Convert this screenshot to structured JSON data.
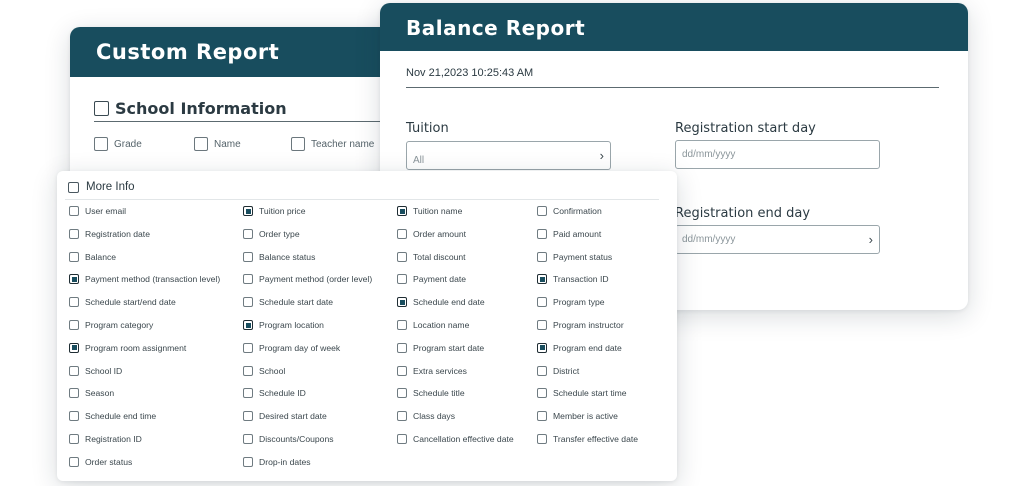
{
  "custom_report": {
    "title": "Custom Report",
    "section_title": "School Information",
    "fields": [
      "Grade",
      "Name",
      "Teacher name"
    ]
  },
  "balance_report": {
    "title": "Balance Report",
    "datetime": "Nov 21,2023  10:25:43 AM",
    "tuition_label": "Tuition",
    "tuition_value": "All",
    "reg_start_label": "Registration start day",
    "reg_start_placeholder": "dd/mm/yyyy",
    "reg_end_label": "Registration end day",
    "reg_end_placeholder": "dd/mm/yyyy"
  },
  "more_info": {
    "title": "More Info",
    "columns": [
      [
        {
          "label": "User email",
          "checked": false
        },
        {
          "label": "Registration date",
          "checked": false
        },
        {
          "label": "Balance",
          "checked": false
        },
        {
          "label": "Payment method (transaction level)",
          "checked": true
        },
        {
          "label": "Schedule start/end date",
          "checked": false
        },
        {
          "label": "Program category",
          "checked": false
        },
        {
          "label": "Program room assignment",
          "checked": true
        },
        {
          "label": "School ID",
          "checked": false
        },
        {
          "label": "Season",
          "checked": false
        },
        {
          "label": "Schedule end time",
          "checked": false
        },
        {
          "label": "Registration ID",
          "checked": false
        },
        {
          "label": "Order status",
          "checked": false
        }
      ],
      [
        {
          "label": "Tuition price",
          "checked": true
        },
        {
          "label": "Order type",
          "checked": false
        },
        {
          "label": "Balance status",
          "checked": false
        },
        {
          "label": "Payment method (order level)",
          "checked": false
        },
        {
          "label": "Schedule start date",
          "checked": false
        },
        {
          "label": "Program location",
          "checked": true
        },
        {
          "label": "Program day of week",
          "checked": false
        },
        {
          "label": "School",
          "checked": false
        },
        {
          "label": "Schedule ID",
          "checked": false
        },
        {
          "label": "Desired start date",
          "checked": false
        },
        {
          "label": "Discounts/Coupons",
          "checked": false
        },
        {
          "label": "Drop-in dates",
          "checked": false
        }
      ],
      [
        {
          "label": "Tuition name",
          "checked": true
        },
        {
          "label": "Order amount",
          "checked": false
        },
        {
          "label": "Total discount",
          "checked": false
        },
        {
          "label": "Payment date",
          "checked": false
        },
        {
          "label": "Schedule end date",
          "checked": true
        },
        {
          "label": "Location name",
          "checked": false
        },
        {
          "label": "Program start date",
          "checked": false
        },
        {
          "label": "Extra services",
          "checked": false
        },
        {
          "label": "Schedule title",
          "checked": false
        },
        {
          "label": "Class days",
          "checked": false
        },
        {
          "label": "Cancellation effective date",
          "checked": false
        }
      ],
      [
        {
          "label": "Confirmation",
          "checked": false
        },
        {
          "label": "Paid amount",
          "checked": false
        },
        {
          "label": "Payment status",
          "checked": false
        },
        {
          "label": "Transaction ID",
          "checked": true
        },
        {
          "label": "Program type",
          "checked": false
        },
        {
          "label": "Program instructor",
          "checked": false
        },
        {
          "label": "Program end date",
          "checked": true
        },
        {
          "label": "District",
          "checked": false
        },
        {
          "label": "Schedule start time",
          "checked": false
        },
        {
          "label": "Member is active",
          "checked": false
        },
        {
          "label": "Transfer effective date",
          "checked": false
        }
      ]
    ]
  }
}
